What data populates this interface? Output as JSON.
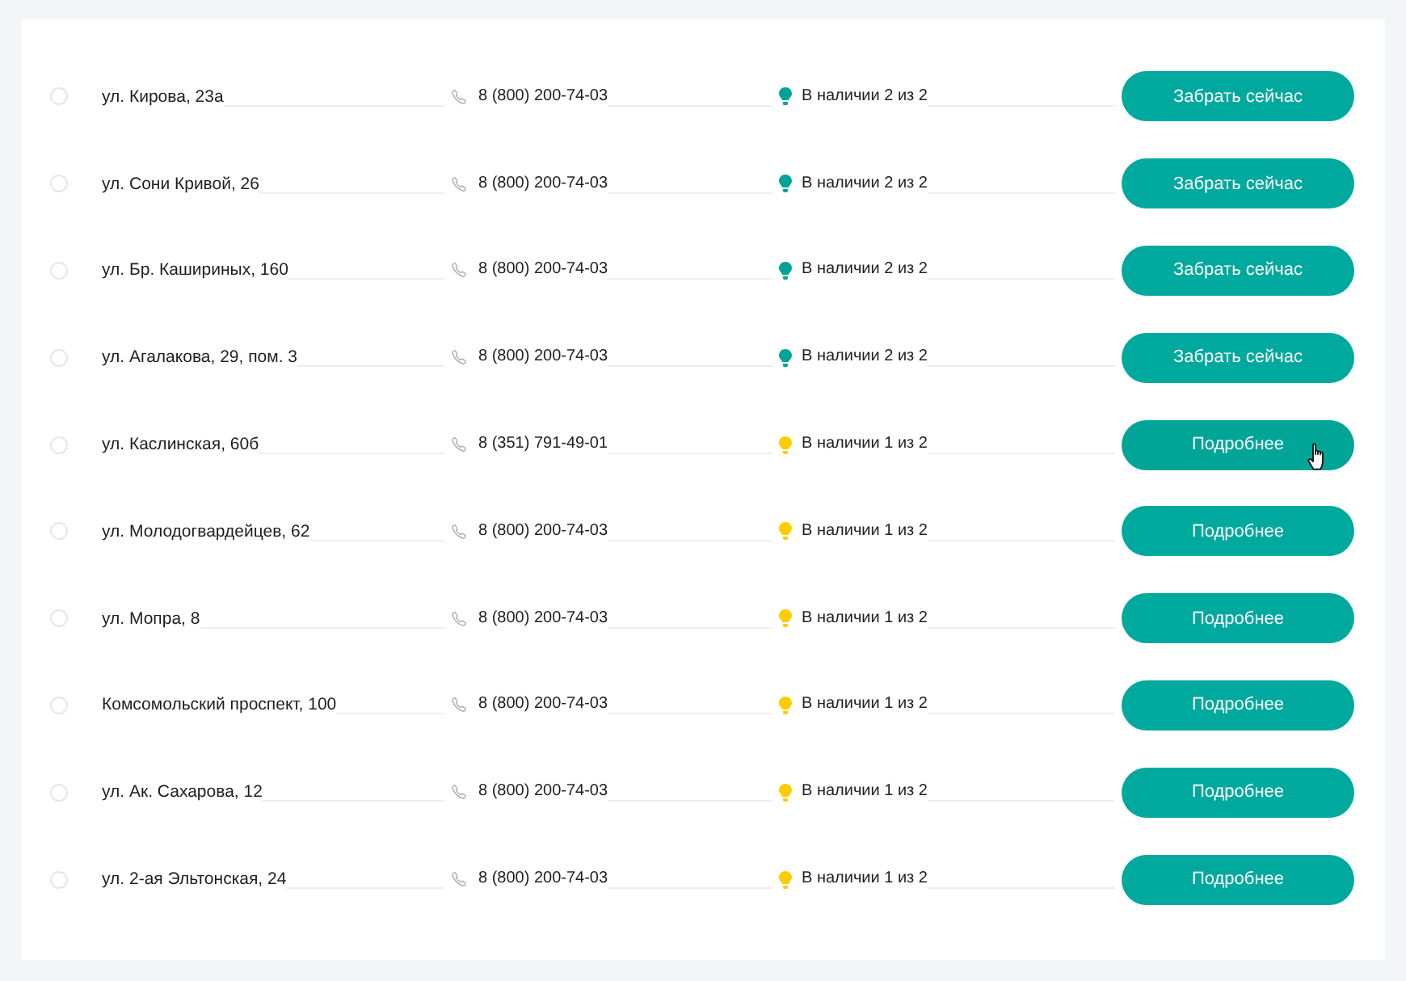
{
  "stores": [
    {
      "selected": false,
      "address": "ул. Кирова, 23а",
      "phone": "8 (800) 200-74-03",
      "availability": {
        "text": "В наличии 2 из 2",
        "color": "#00a396"
      },
      "button": {
        "label": "Забрать сейчас",
        "hovered": false
      }
    },
    {
      "selected": false,
      "address": "ул. Сони Кривой, 26",
      "phone": "8 (800) 200-74-03",
      "availability": {
        "text": "В наличии 2 из 2",
        "color": "#00a396"
      },
      "button": {
        "label": "Забрать сейчас",
        "hovered": false
      }
    },
    {
      "selected": false,
      "address": "ул. Бр. Кашириных, 160",
      "phone": "8 (800) 200-74-03",
      "availability": {
        "text": "В наличии 2 из 2",
        "color": "#00a396"
      },
      "button": {
        "label": "Забрать сейчас",
        "hovered": false
      }
    },
    {
      "selected": false,
      "address": "ул. Агалакова, 29, пом. 3",
      "phone": "8 (800) 200-74-03",
      "availability": {
        "text": "В наличии 2 из 2",
        "color": "#00a396"
      },
      "button": {
        "label": "Забрать сейчас",
        "hovered": false
      }
    },
    {
      "selected": false,
      "address": "ул. Каслинская, 60б",
      "phone": "8 (351) 791-49-01",
      "availability": {
        "text": "В наличии 1 из 2",
        "color": "#ffcc00"
      },
      "button": {
        "label": "Подробнее",
        "hovered": true
      }
    },
    {
      "selected": false,
      "address": "ул. Молодогвардейцев, 62",
      "phone": "8 (800) 200-74-03",
      "availability": {
        "text": "В наличии 1 из 2",
        "color": "#ffcc00"
      },
      "button": {
        "label": "Подробнее",
        "hovered": false
      }
    },
    {
      "selected": false,
      "address": "ул. Мопра, 8",
      "phone": "8 (800) 200-74-03",
      "availability": {
        "text": "В наличии 1 из 2",
        "color": "#ffcc00"
      },
      "button": {
        "label": "Подробнее",
        "hovered": false
      }
    },
    {
      "selected": false,
      "address": "Комсомольский проспект, 100",
      "phone": "8 (800) 200-74-03",
      "availability": {
        "text": "В наличии 1 из 2",
        "color": "#ffcc00"
      },
      "button": {
        "label": "Подробнее",
        "hovered": false
      }
    },
    {
      "selected": false,
      "address": "ул. Ак. Сахарова, 12",
      "phone": "8 (800) 200-74-03",
      "availability": {
        "text": "В наличии 1 из 2",
        "color": "#ffcc00"
      },
      "button": {
        "label": "Подробнее",
        "hovered": false
      }
    },
    {
      "selected": false,
      "address": "ул. 2-ая Эльтонская, 24",
      "phone": "8 (800) 200-74-03",
      "availability": {
        "text": "В наличии 1 из 2",
        "color": "#ffcc00"
      },
      "button": {
        "label": "Подробнее",
        "hovered": false
      }
    }
  ]
}
